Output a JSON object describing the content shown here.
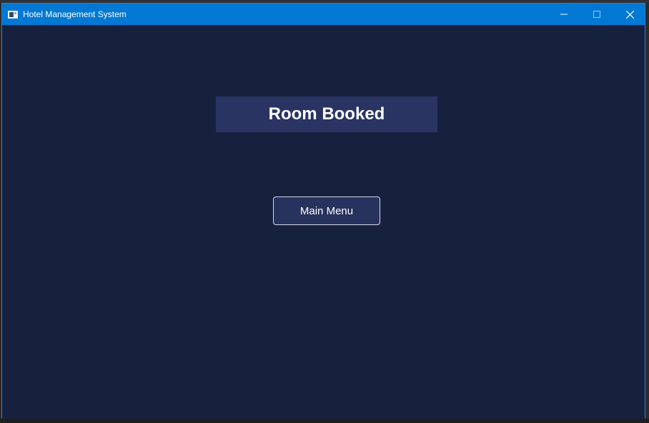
{
  "window": {
    "title": "Hotel Management System",
    "controls": {
      "minimize_icon": "minimize-icon",
      "maximize_icon": "maximize-icon",
      "close_icon": "close-icon"
    }
  },
  "content": {
    "heading": "Room Booked",
    "main_menu_label": "Main Menu"
  },
  "colors": {
    "titlebar": "#0078d4",
    "background": "#16213e",
    "heading_bg": "#2a3463",
    "button_bg": "#27325d",
    "button_border": "#d7dbe6",
    "text": "#ffffff"
  }
}
